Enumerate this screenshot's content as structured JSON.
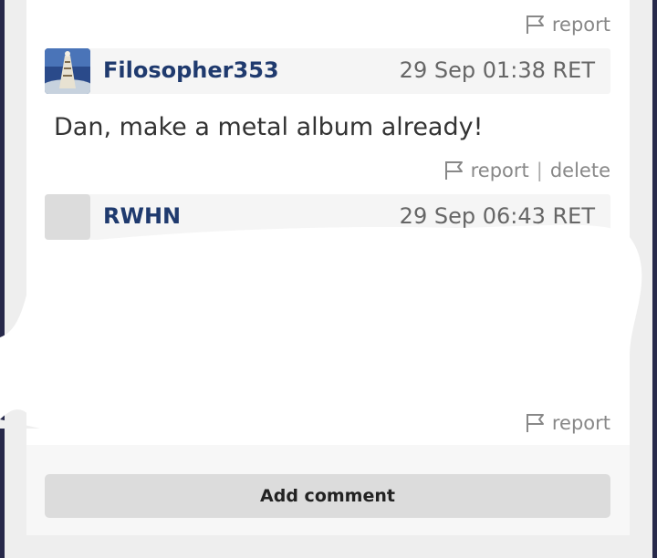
{
  "comments": [
    {
      "author": "Filosopher353",
      "timestamp": "29 Sep 01:38 RET",
      "text": "Dan, make a metal album already!",
      "actions": {
        "report": "report",
        "separator": "|",
        "delete": "delete"
      }
    },
    {
      "author": "RWHN",
      "timestamp": "29 Sep 06:43 RET",
      "actions": {
        "report": "report"
      }
    }
  ],
  "top_actions": {
    "report": "report"
  },
  "add_comment_label": "Add comment",
  "colors": {
    "author": "#1f3a6e",
    "muted": "#888888",
    "button_bg": "#dcdcdc",
    "frame": "#27294a"
  },
  "icons": {
    "report": "flag-icon"
  }
}
